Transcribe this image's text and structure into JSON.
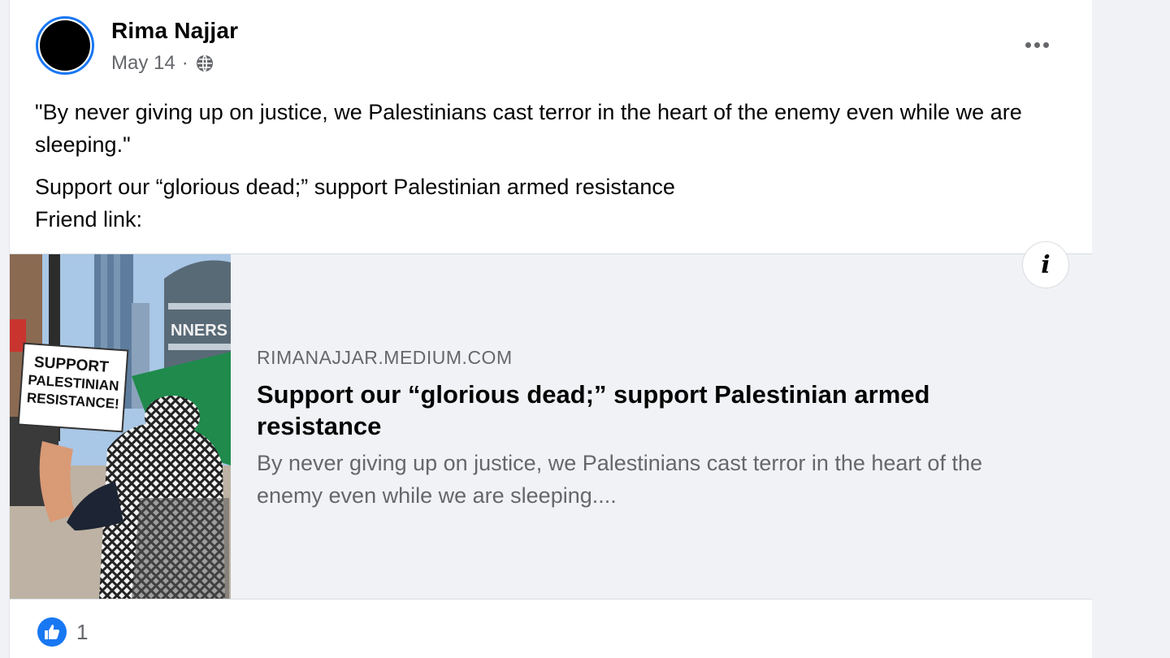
{
  "post": {
    "author": "Rima Najjar",
    "date": "May 14",
    "separator": "·",
    "audience_icon": "globe-icon",
    "menu_icon": "more-options-icon",
    "text_paragraph_1": "\"By never giving up on justice, we Palestinians cast terror in the heart of the enemy even while we are sleeping.\"",
    "text_line_2": "Support our “glorious dead;” support Palestinian armed resistance",
    "text_line_3": "Friend link:"
  },
  "link_card": {
    "domain": "RIMANAJJAR.MEDIUM.COM",
    "title": "Support our “glorious dead;” support Palestinian armed resistance",
    "description": "By never giving up on justice, we Palestinians cast terror in the heart of the enemy even while we are sleeping....",
    "info_label": "i",
    "image": {
      "sign_line_1": "SUPPORT",
      "sign_line_2": "PALESTINIAN",
      "sign_line_3": "RESISTANCE!",
      "building_text": "NNERS"
    }
  },
  "reactions": {
    "icon": "like-icon",
    "count": "1"
  },
  "colors": {
    "accent": "#1877f2",
    "secondary_text": "#65676b",
    "card_bg": "#f0f2f5"
  }
}
